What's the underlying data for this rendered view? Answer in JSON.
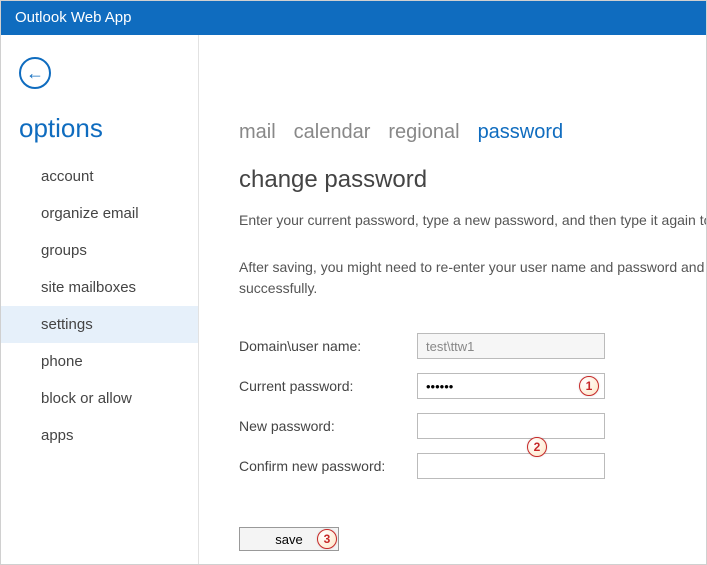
{
  "app_title": "Outlook Web App",
  "sidebar": {
    "title": "options",
    "items": [
      {
        "label": "account"
      },
      {
        "label": "organize email"
      },
      {
        "label": "groups"
      },
      {
        "label": "site mailboxes"
      },
      {
        "label": "settings",
        "active": true
      },
      {
        "label": "phone"
      },
      {
        "label": "block or allow"
      },
      {
        "label": "apps"
      }
    ]
  },
  "tabs": [
    {
      "label": "mail"
    },
    {
      "label": "calendar"
    },
    {
      "label": "regional"
    },
    {
      "label": "password",
      "active": true
    }
  ],
  "page": {
    "heading": "change password",
    "desc1": "Enter your current password, type a new password, and then type it again to confirm it.",
    "desc2_a": "After saving, you might need to re-enter your user name and password and sign in agai",
    "desc2_b": "successfully."
  },
  "form": {
    "domain_label": "Domain\\user name:",
    "domain_value": "test\\ttw1",
    "current_label": "Current password:",
    "current_value": "••••••",
    "new_label": "New password:",
    "new_value": "",
    "confirm_label": "Confirm new password:",
    "confirm_value": ""
  },
  "buttons": {
    "save": "save"
  },
  "callouts": {
    "c1": "1",
    "c2": "2",
    "c3": "3"
  }
}
